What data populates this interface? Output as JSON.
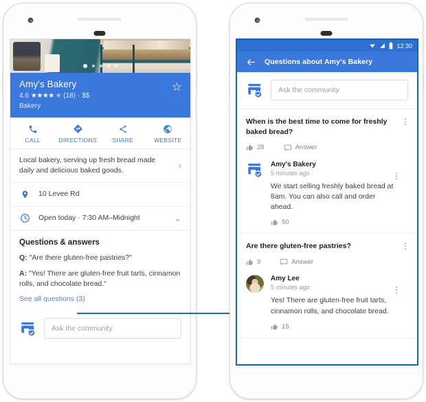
{
  "left_phone": {
    "photo_carousel": {
      "name": "bakery-photo",
      "dots_total": 5,
      "active_index": 0
    },
    "business": {
      "name": "Amy's Bakery",
      "rating_value": "4.6",
      "stars": "★★★★",
      "half_star": "★",
      "review_count": "(18)",
      "separator": "·",
      "price": "$$",
      "category": "Bakery",
      "save_icon": "☆"
    },
    "actions": [
      {
        "label": "CALL",
        "icon": "phone-icon"
      },
      {
        "label": "DIRECTIONS",
        "icon": "directions-icon"
      },
      {
        "label": "SHARE",
        "icon": "share-icon"
      },
      {
        "label": "WEBSITE",
        "icon": "globe-icon"
      }
    ],
    "description": {
      "text": "Local bakery, serving up fresh bread made daily and delicious baked goods.",
      "chevron": "›"
    },
    "address": {
      "icon": "place-pin-icon",
      "text": "10 Levee Rd"
    },
    "hours": {
      "icon": "clock-icon",
      "text": "Open today · 7:30 AM–Midnight",
      "chevron": "⌄"
    },
    "qa_section": {
      "heading": "Questions & answers",
      "question_prefix": "Q:",
      "question_text": "\"Are there gluten-free pastries?\"",
      "answer_prefix": "A:",
      "answer_text": "\"Yes! There are gluten-free fruit tarts, cinnamon rolls, and chocolate bread.\"",
      "see_all_label": "See all questions (3)"
    },
    "ask_box": {
      "icon": "verified-store-icon",
      "placeholder": "Ask the community"
    }
  },
  "right_phone": {
    "status_bar": {
      "wifi_icon": "wifi-icon",
      "signal_icon": "signal-icon",
      "battery_icon": "battery-icon",
      "time": "12:30"
    },
    "app_bar": {
      "back_icon": "back-arrow-icon",
      "title": "Questions about Amy's Bakery"
    },
    "ask_box": {
      "icon": "verified-store-icon",
      "placeholder": "Ask the community"
    },
    "questions": [
      {
        "question": "When is the best time to come for freshly baked bread?",
        "like_count": "28",
        "answer_label": "Answer",
        "overflow_icon": "more-vert-icon",
        "answers": [
          {
            "author": "Amy's Bakery",
            "avatar": "verified-store-icon",
            "timestamp": "5 minutes ago",
            "text": "We start selling freshly baked bread at 8am. You can also call and order ahead.",
            "like_count": "50",
            "overflow_icon": "more-vert-icon"
          }
        ]
      },
      {
        "question": "Are there gluten-free pastries?",
        "like_count": "9",
        "answer_label": "Answer",
        "overflow_icon": "more-vert-icon",
        "answers": [
          {
            "author": "Amy Lee",
            "avatar": "user-photo-avatar",
            "timestamp": "5 minutes ago",
            "text": "Yes! There are gluten-free fruit tarts, cinnamon rolls, and chocolate bread.",
            "like_count": "15",
            "overflow_icon": "more-vert-icon"
          }
        ]
      }
    ]
  },
  "colors": {
    "brand_blue": "#3b78dc",
    "status_blue": "#2f6fd0",
    "link_blue": "#4a88d6",
    "connector_blue": "#1a6fae",
    "highlight_border": "#1565a8"
  }
}
